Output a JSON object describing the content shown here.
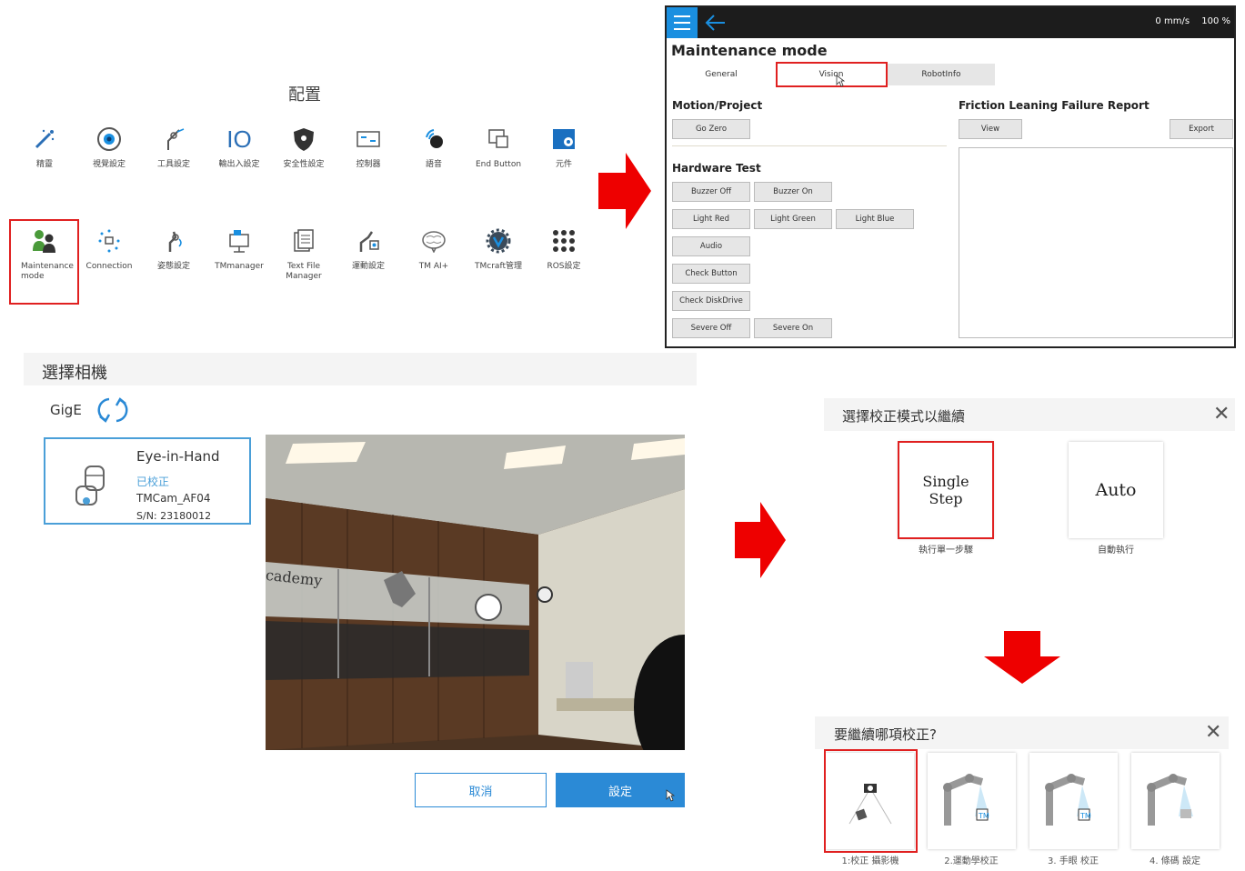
{
  "settings": {
    "title": "配置",
    "row1": [
      {
        "label": "精靈",
        "icon": "magic-wand-icon"
      },
      {
        "label": "視覺設定",
        "icon": "eye-icon"
      },
      {
        "label": "工具設定",
        "icon": "tool-icon"
      },
      {
        "label": "輸出入設定",
        "icon": "io-icon",
        "glyph": "IO"
      },
      {
        "label": "安全性設定",
        "icon": "shield-icon"
      },
      {
        "label": "控制器",
        "icon": "controller-icon"
      },
      {
        "label": "語音",
        "icon": "voice-icon"
      },
      {
        "label": "End Button",
        "icon": "end-button-icon"
      },
      {
        "label": "元件",
        "icon": "component-icon"
      }
    ],
    "row2": [
      {
        "label": "Maintenance mode",
        "icon": "maintenance-icon"
      },
      {
        "label": "Connection",
        "icon": "connection-icon"
      },
      {
        "label": "姿態設定",
        "icon": "pose-icon"
      },
      {
        "label": "TMmanager",
        "icon": "tmmanager-icon"
      },
      {
        "label": "Text File Manager",
        "icon": "text-file-icon"
      },
      {
        "label": "運動設定",
        "icon": "motion-settings-icon"
      },
      {
        "label": "TM AI+",
        "icon": "brain-icon"
      },
      {
        "label": "TMcraft管理",
        "icon": "craft-icon"
      },
      {
        "label": "ROS設定",
        "icon": "grid-dots-icon"
      }
    ]
  },
  "maintenance": {
    "status_speed": "0 mm/s",
    "status_percent": "100 %",
    "title": "Maintenance mode",
    "tabs": [
      "General",
      "Vision",
      "RobotInfo"
    ],
    "motion_title": "Motion/Project",
    "go_zero": "Go Zero",
    "hardware_title": "Hardware Test",
    "hw_buttons": {
      "buzzer_off": "Buzzer Off",
      "buzzer_on": "Buzzer On",
      "light_red": "Light Red",
      "light_green": "Light Green",
      "light_blue": "Light Blue",
      "audio": "Audio",
      "check_button": "Check Button",
      "check_diskdrive": "Check DiskDrive",
      "severe_off": "Severe Off",
      "severe_on": "Severe On"
    },
    "friction_title": "Friction Leaning Failure Report",
    "view": "View",
    "export": "Export"
  },
  "camera_select": {
    "title": "選擇相機",
    "interface": "GigE",
    "camera": {
      "name": "Eye-in-Hand",
      "status": "已校正",
      "model": "TMCam_AF04",
      "serial": "S/N: 23180012"
    },
    "preview_text": "cademy",
    "cancel": "取消",
    "confirm": "設定"
  },
  "calibration_mode": {
    "title": "選擇校正模式以繼續",
    "single_step": "Single Step",
    "single_step_caption": "執行單一步驟",
    "auto": "Auto",
    "auto_caption": "自動執行"
  },
  "calibration_which": {
    "title": "要繼續哪項校正?",
    "items": [
      {
        "label": "1:校正 攝影機"
      },
      {
        "label": "2.運動學校正"
      },
      {
        "label": "3. 手眼 校正"
      },
      {
        "label": "4. 條碼 設定"
      }
    ]
  },
  "colors": {
    "highlight_red": "#e02020",
    "arrow_red": "#ee0000",
    "accent_blue": "#2b8ad6",
    "titlebar_dark": "#1c1c1c"
  }
}
